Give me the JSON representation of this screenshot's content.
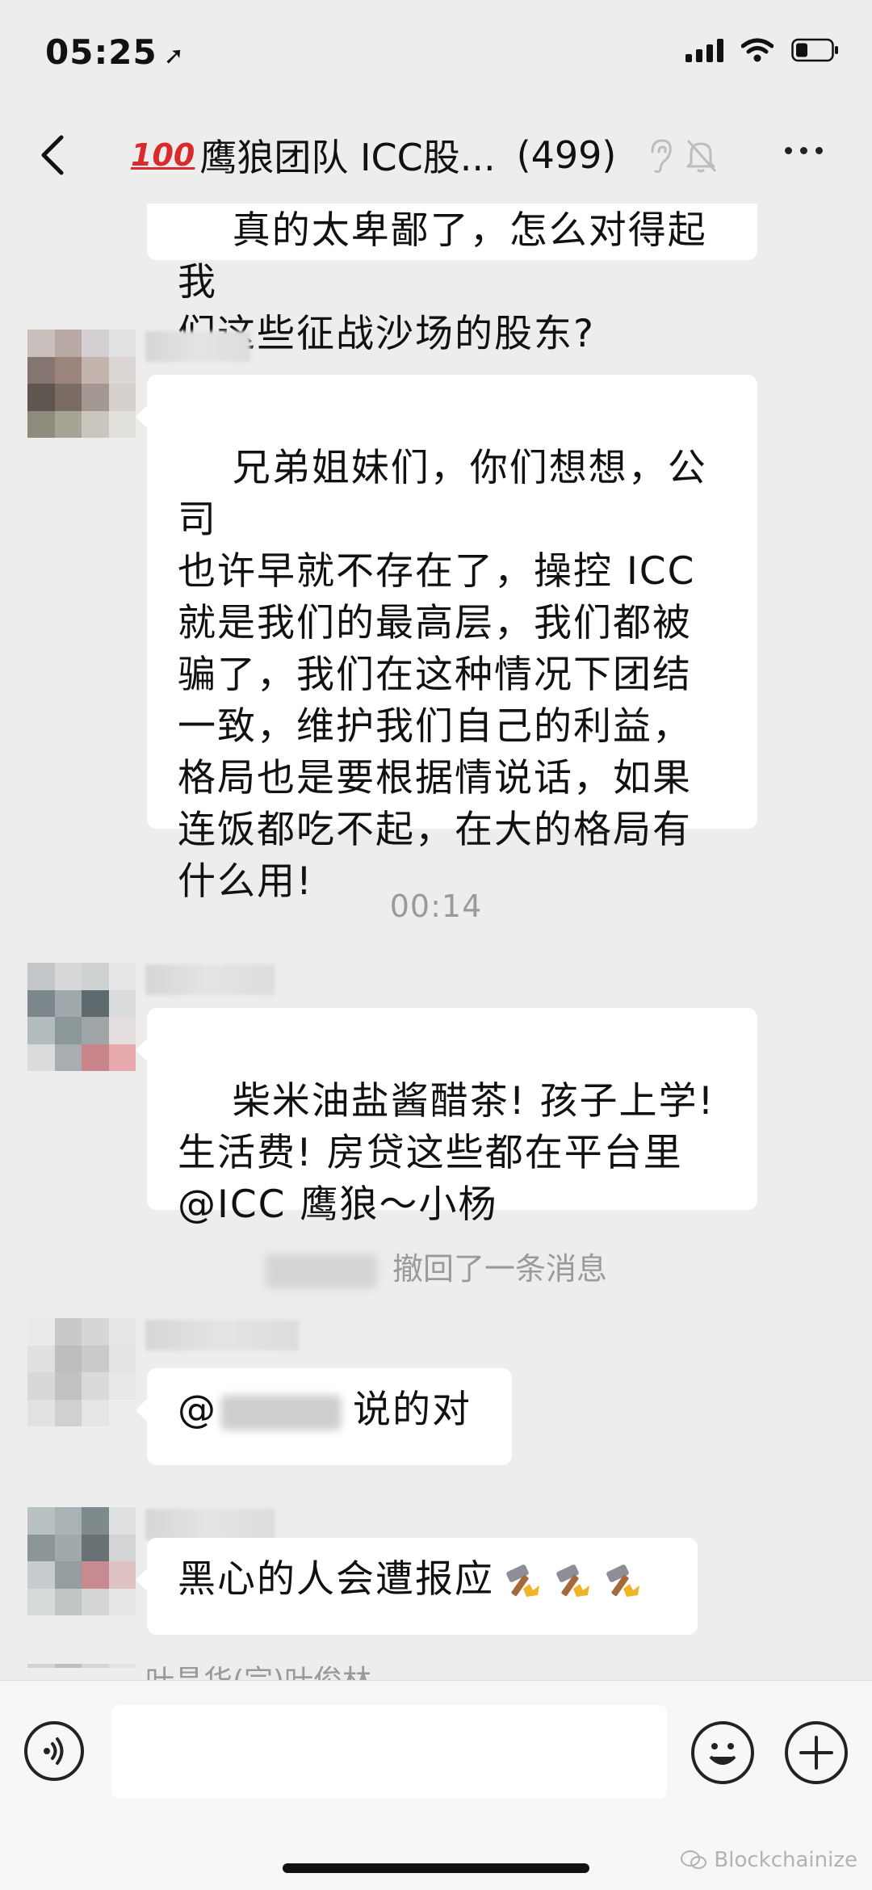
{
  "status": {
    "time": "05:25"
  },
  "nav": {
    "title": "鹰狼团队 ICC股...",
    "member_count": "(499)"
  },
  "messages": {
    "partial_top": "真的太卑鄙了，怎么对得起我\n们这些征战沙场的股东?",
    "msg1": "兄弟姐妹们，你们想想，公司\n也许早就不存在了，操控 ICC\n就是我们的最高层，我们都被\n骗了，我们在这种情况下团结\n一致，维护我们自己的利益，\n格局也是要根据情说话，如果\n连饭都吃不起，在大的格局有\n什么用!",
    "time_label": "00:14",
    "msg2": "柴米油盐酱醋茶! 孩子上学!\n生活费! 房贷这些都在平台里\n@ICC 鹰狼～小杨",
    "recall_text": "撤回了一条消息",
    "msg3_prefix": "@",
    "msg3_suffix": "说的对",
    "msg4": "黑心的人会遭报应",
    "partial_bottom_sender": "叶昌华(宗)叶俊林"
  },
  "watermark": "Blockchainize",
  "colors": {
    "background": "#ededed",
    "bubble": "#ffffff",
    "badge": "#d92b2b",
    "meta_text": "#9a9a9a"
  }
}
